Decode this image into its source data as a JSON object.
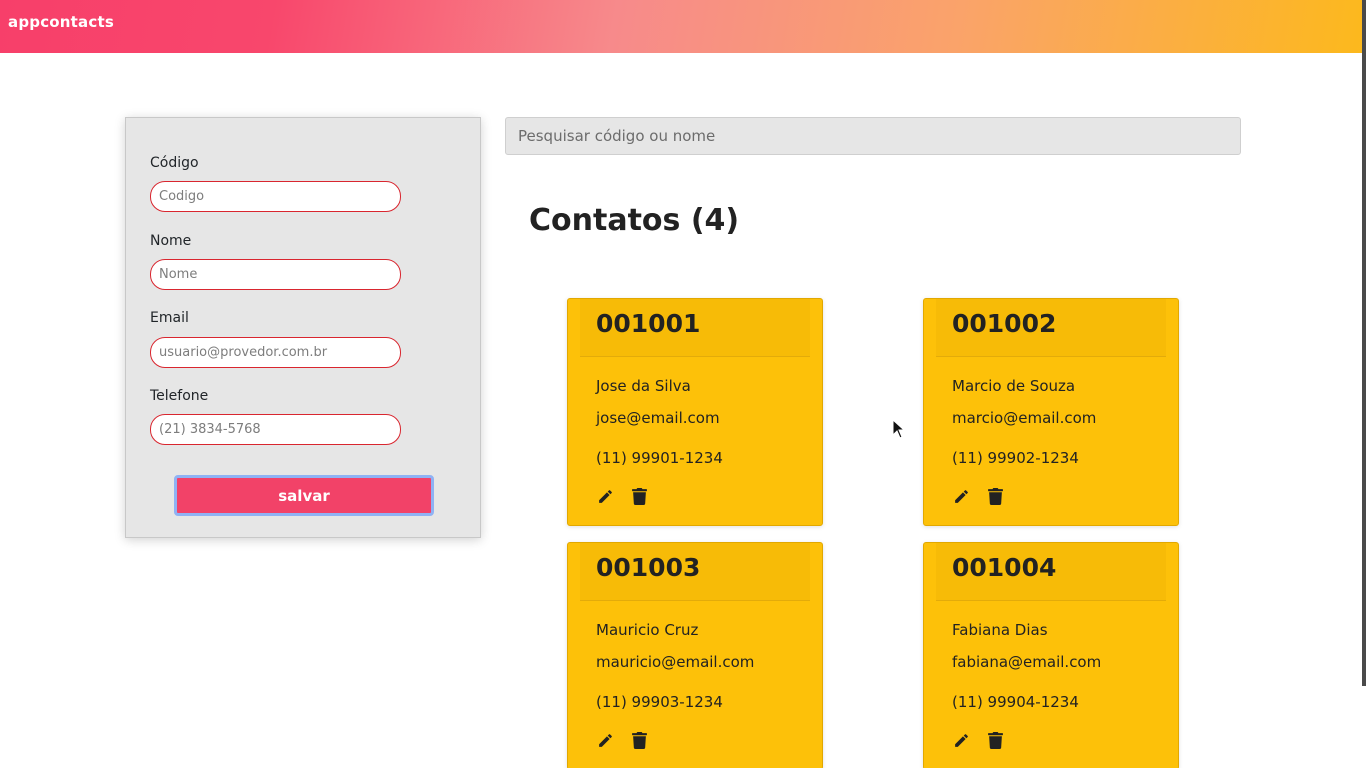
{
  "header": {
    "brand": "appcontacts"
  },
  "form": {
    "fields": [
      {
        "label": "Código",
        "placeholder": "Codigo",
        "value": ""
      },
      {
        "label": "Nome",
        "placeholder": "Nome",
        "value": ""
      },
      {
        "label": "Email",
        "placeholder": "usuario@provedor.com.br",
        "value": ""
      },
      {
        "label": "Telefone",
        "placeholder": "(21) 3834-5768",
        "value": ""
      }
    ],
    "save_label": "salvar"
  },
  "search": {
    "placeholder": "Pesquisar código ou nome",
    "value": ""
  },
  "contacts": {
    "title": "Contatos",
    "count_text": "(4)",
    "items": [
      {
        "code": "001001",
        "name": "Jose da Silva",
        "email": "jose@email.com",
        "phone": "(11) 99901-1234"
      },
      {
        "code": "001002",
        "name": "Marcio de Souza",
        "email": "marcio@email.com",
        "phone": "(11) 99902-1234"
      },
      {
        "code": "001003",
        "name": "Mauricio Cruz",
        "email": "mauricio@email.com",
        "phone": "(11) 99903-1234"
      },
      {
        "code": "001004",
        "name": "Fabiana Dias",
        "email": "fabiana@email.com",
        "phone": "(11) 99904-1234"
      }
    ]
  },
  "icons": {
    "edit": "pencil-icon",
    "delete": "trash-icon"
  },
  "colors": {
    "accent": "#f24268",
    "card": "#fdc109",
    "header_start": "#f73f6a",
    "header_end": "#fcb91c"
  }
}
